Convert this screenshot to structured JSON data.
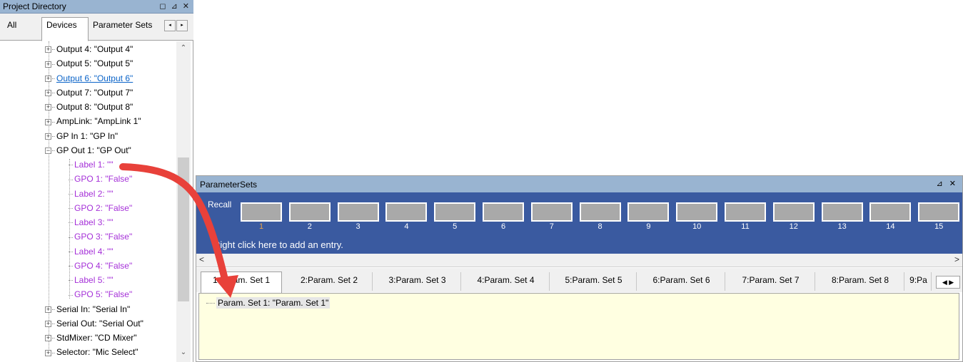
{
  "project_directory": {
    "title": "Project Directory",
    "title_buttons": "◻ ⊿ ✕",
    "tabs": [
      "All",
      "Devices",
      "Parameter Sets"
    ],
    "active_tab": "Devices",
    "tab_scroll_left": "◂",
    "tab_scroll_right": "▸",
    "tree": [
      {
        "label": "Output 4: \"Output 4\"",
        "expander": "+",
        "style": "normal"
      },
      {
        "label": "Output 5: \"Output 5\"",
        "expander": "+",
        "style": "normal"
      },
      {
        "label": "Output 6: \"Output 6\"",
        "expander": "+",
        "style": "link"
      },
      {
        "label": "Output 7: \"Output 7\"",
        "expander": "+",
        "style": "normal"
      },
      {
        "label": "Output 8: \"Output 8\"",
        "expander": "+",
        "style": "normal"
      },
      {
        "label": "AmpLink: \"AmpLink 1\"",
        "expander": "+",
        "style": "normal"
      },
      {
        "label": "GP In 1: \"GP In\"",
        "expander": "+",
        "style": "normal"
      },
      {
        "label": "GP Out 1: \"GP Out\"",
        "expander": "−",
        "style": "normal"
      },
      {
        "label": "Label 1: \"\"",
        "expander": "",
        "style": "purple"
      },
      {
        "label": "GPO 1: \"False\"",
        "expander": "",
        "style": "purple"
      },
      {
        "label": "Label 2: \"\"",
        "expander": "",
        "style": "purple"
      },
      {
        "label": "GPO 2: \"False\"",
        "expander": "",
        "style": "purple"
      },
      {
        "label": "Label 3: \"\"",
        "expander": "",
        "style": "purple"
      },
      {
        "label": "GPO 3: \"False\"",
        "expander": "",
        "style": "purple"
      },
      {
        "label": "Label 4: \"\"",
        "expander": "",
        "style": "purple"
      },
      {
        "label": "GPO 4: \"False\"",
        "expander": "",
        "style": "purple"
      },
      {
        "label": "Label 5: \"\"",
        "expander": "",
        "style": "purple"
      },
      {
        "label": "GPO 5: \"False\"",
        "expander": "",
        "style": "purple"
      },
      {
        "label": "Serial In: \"Serial In\"",
        "expander": "+",
        "style": "normal"
      },
      {
        "label": "Serial Out: \"Serial Out\"",
        "expander": "+",
        "style": "normal"
      },
      {
        "label": "StdMixer: \"CD Mixer\"",
        "expander": "+",
        "style": "normal"
      },
      {
        "label": "Selector: \"Mic Select\"",
        "expander": "+",
        "style": "normal"
      }
    ],
    "scroll_up": "⌃",
    "scroll_down": "⌄"
  },
  "parameter_sets": {
    "title": "ParameterSets",
    "title_buttons": "⊿ ✕",
    "recall_label": "Recall",
    "slots": [
      "1",
      "2",
      "3",
      "4",
      "5",
      "6",
      "7",
      "8",
      "9",
      "10",
      "11",
      "12",
      "13",
      "14",
      "15"
    ],
    "selected_slot": "1",
    "hint": "Right click here to add an entry.",
    "hscroll_left": "<",
    "hscroll_right": ">",
    "tabs": [
      "1:Param. Set 1",
      "2:Param. Set 2",
      "3:Param. Set 3",
      "4:Param. Set 4",
      "5:Param. Set 5",
      "6:Param. Set 6",
      "7:Param. Set 7",
      "8:Param. Set 8",
      "9:Pa"
    ],
    "active_tab": "1:Param. Set 1",
    "tab_arrows": "◀ ▶",
    "entry": "Param. Set 1: \"Param. Set 1\""
  },
  "colors": {
    "titlebar": "#99b4d1",
    "recall_bg": "#3a5aa0",
    "body_bg": "#ffffe1",
    "arrow": "#e8413a",
    "purple_text": "#a530d8",
    "link_text": "#0a63c8"
  }
}
